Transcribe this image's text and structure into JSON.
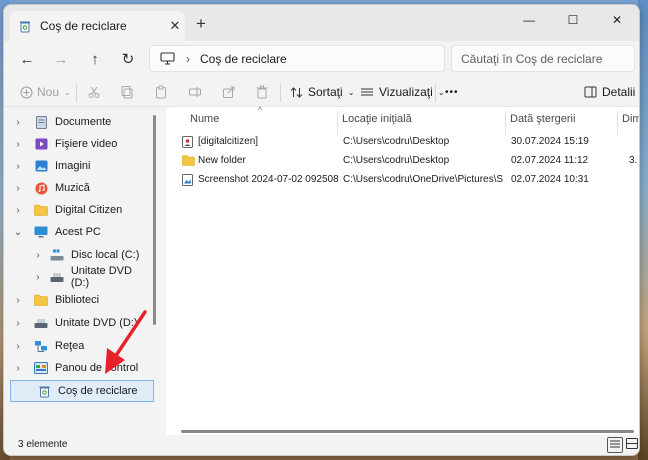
{
  "window": {
    "tab_title": "Coş de reciclare",
    "tab_close": "✕",
    "new_tab": "+",
    "controls": {
      "minimize": "—",
      "maximize": "☐",
      "close": "✕"
    }
  },
  "nav": {
    "back": "←",
    "forward": "→",
    "up": "↑",
    "refresh": "↻",
    "breadcrumb": "Coş de reciclare",
    "search_placeholder": "Căutaţi în Coş de reciclare"
  },
  "command_bar": {
    "new_label": "Nou",
    "sort_label": "Sortaţi",
    "view_label": "Vizualizaţi",
    "more": "•••",
    "details_label": "Detalii"
  },
  "sidebar": {
    "items": [
      {
        "label": "Documente",
        "chevron": "›",
        "icon": "documents-icon"
      },
      {
        "label": "Fişiere video",
        "chevron": "›",
        "icon": "videos-icon"
      },
      {
        "label": "Imagini",
        "chevron": "›",
        "icon": "pictures-icon"
      },
      {
        "label": "Muzică",
        "chevron": "›",
        "icon": "music-icon"
      },
      {
        "label": "Digital Citizen",
        "chevron": "›",
        "icon": "folder-icon"
      },
      {
        "label": "Acest PC",
        "chevron": "⌄",
        "icon": "pc-icon"
      },
      {
        "label": "Disc local (C:)",
        "chevron": "›",
        "icon": "drive-icon"
      },
      {
        "label": "Unitate DVD (D:)",
        "chevron": "›",
        "icon": "dvd-icon"
      },
      {
        "label": "Biblioteci",
        "chevron": "›",
        "icon": "libraries-icon"
      },
      {
        "label": "Unitate DVD (D:)",
        "chevron": "›",
        "icon": "dvd-icon"
      },
      {
        "label": "Reţea",
        "chevron": "›",
        "icon": "network-icon"
      },
      {
        "label": "Panou de control",
        "chevron": "›",
        "icon": "control-panel-icon"
      },
      {
        "label": "Coş de reciclare",
        "chevron": "",
        "icon": "recycle-bin-icon"
      }
    ]
  },
  "table": {
    "columns": [
      "Nume",
      "Locaţie iniţială",
      "Dată ştergerii",
      "Dime"
    ],
    "rows": [
      {
        "name": "[digitalcitizen]",
        "location": "C:\\Users\\codru\\Desktop",
        "date": "30.07.2024 15:19",
        "size": "",
        "icon": "user-file-icon"
      },
      {
        "name": "New folder",
        "location": "C:\\Users\\codru\\Desktop",
        "date": "02.07.2024 11:12",
        "size": "3.",
        "icon": "folder-icon"
      },
      {
        "name": "Screenshot 2024-07-02 092508",
        "location": "C:\\Users\\codru\\OneDrive\\Pictures\\Scree...",
        "date": "02.07.2024 10:31",
        "size": "",
        "icon": "image-file-icon"
      }
    ]
  },
  "status": {
    "count": "3 elemente"
  },
  "colors": {
    "accent": "#0067c0",
    "selected_bg": "#e0ecf8",
    "annotation_arrow": "#e8202a"
  }
}
